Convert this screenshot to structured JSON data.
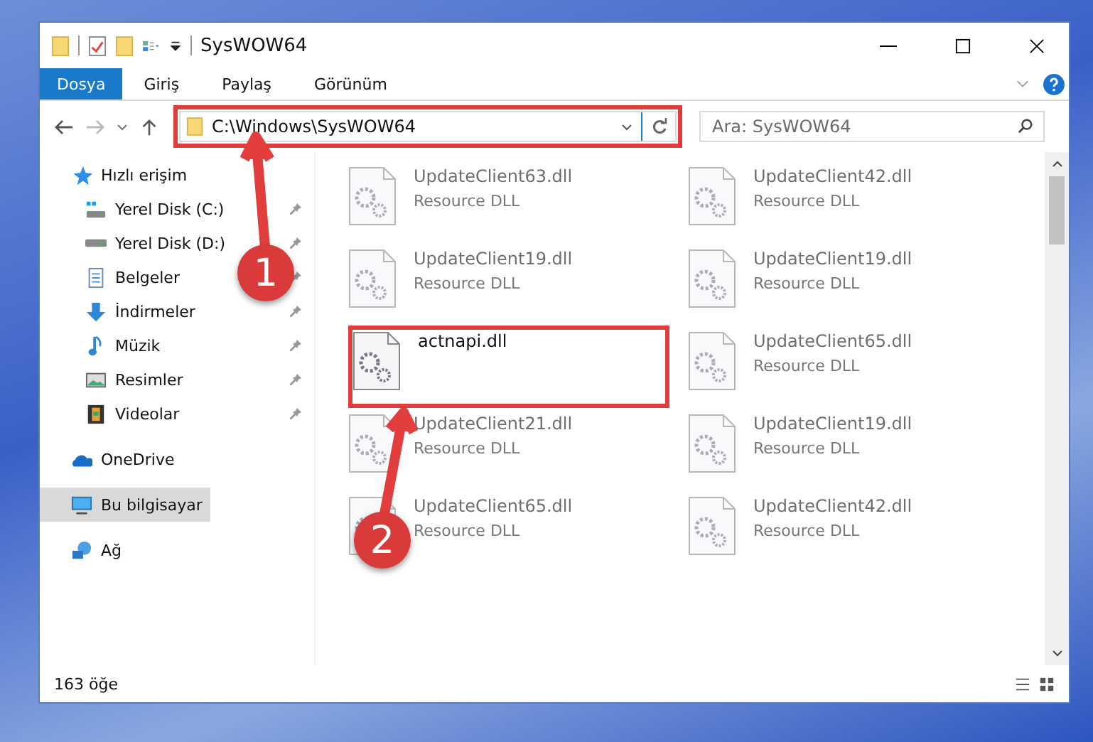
{
  "window": {
    "title": "SysWOW64"
  },
  "ribbon_tabs": [
    {
      "label": "Dosya",
      "selected": true
    },
    {
      "label": "Giriş",
      "selected": false
    },
    {
      "label": "Paylaş",
      "selected": false
    },
    {
      "label": "Görünüm",
      "selected": false
    }
  ],
  "address": {
    "value": "C:\\Windows\\SysWOW64",
    "highlighted": true
  },
  "search": {
    "placeholder": "Ara: SysWOW64"
  },
  "sidebar": {
    "items": [
      {
        "label": "Hızlı erişim",
        "kind": "star",
        "selected": false,
        "children": [
          {
            "label": "Yerel Disk (C:)",
            "kind": "drive-c",
            "pinned": true,
            "selected": false
          },
          {
            "label": "Yerel Disk (D:)",
            "kind": "drive",
            "pinned": true,
            "selected": false
          },
          {
            "label": "Belgeler",
            "kind": "document",
            "pinned": true,
            "selected": false
          },
          {
            "label": "İndirmeler",
            "kind": "download",
            "pinned": true,
            "selected": false
          },
          {
            "label": "Müzik",
            "kind": "music",
            "pinned": true,
            "selected": false
          },
          {
            "label": "Resimler",
            "kind": "picture",
            "pinned": true,
            "selected": false
          },
          {
            "label": "Videolar",
            "kind": "video",
            "pinned": true,
            "selected": false
          }
        ]
      },
      {
        "label": "OneDrive",
        "kind": "cloud",
        "selected": false
      },
      {
        "label": "Bu bilgisayar",
        "kind": "computer",
        "selected": true
      },
      {
        "label": "Ağ",
        "kind": "network",
        "selected": false
      }
    ]
  },
  "files": [
    {
      "name": "UpdateClient63.dll",
      "type": "Resource DLL",
      "faded": true,
      "highlighted": false
    },
    {
      "name": "UpdateClient42.dll",
      "type": "Resource DLL",
      "faded": true,
      "highlighted": false
    },
    {
      "name": "UpdateClient19.dll",
      "type": "Resource DLL",
      "faded": true,
      "highlighted": false
    },
    {
      "name": "UpdateClient19.dll",
      "type": "Resource DLL",
      "faded": true,
      "highlighted": false
    },
    {
      "name": "actnapi.dll",
      "faded": false,
      "highlighted": true
    },
    {
      "name": "UpdateClient65.dll",
      "type": "Resource DLL",
      "faded": true,
      "highlighted": false
    },
    {
      "name": "UpdateClient21.dll",
      "type": "Resource DLL",
      "faded": true,
      "highlighted": false
    },
    {
      "name": "UpdateClient19.dll",
      "type": "Resource DLL",
      "faded": true,
      "highlighted": false
    },
    {
      "name": "UpdateClient65.dll",
      "type": "Resource DLL",
      "faded": true,
      "highlighted": false
    },
    {
      "name": "UpdateClient42.dll",
      "type": "Resource DLL",
      "faded": true,
      "highlighted": false
    }
  ],
  "status_bar": {
    "count": "163 öğe"
  },
  "annotations": [
    {
      "number": "1"
    },
    {
      "number": "2"
    }
  ]
}
